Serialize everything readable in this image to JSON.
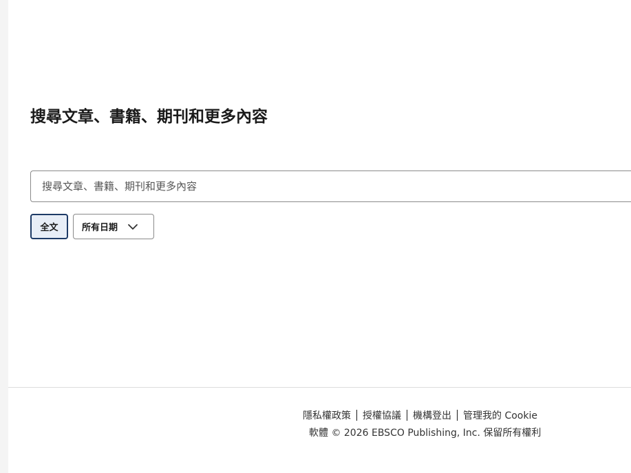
{
  "main": {
    "title": "搜尋文章、書籍、期刊和更多內容",
    "search": {
      "placeholder": "搜尋文章、書籍、期刊和更多內容",
      "value": ""
    },
    "filters": {
      "fulltext_label": "全文",
      "date_label": "所有日期",
      "date_icon": "chevron-down-icon"
    }
  },
  "footer": {
    "links": [
      {
        "label": "隱私權政策"
      },
      {
        "label": "授權協議"
      },
      {
        "label": "機構登出"
      },
      {
        "label": "管理我的 Cookie"
      }
    ],
    "copyright": "軟體 © 2026 EBSCO Publishing, Inc. 保留所有權利"
  },
  "colors": {
    "accent": "#1d3a66",
    "border": "#8a8a8a",
    "divider": "#dcdcdc"
  }
}
